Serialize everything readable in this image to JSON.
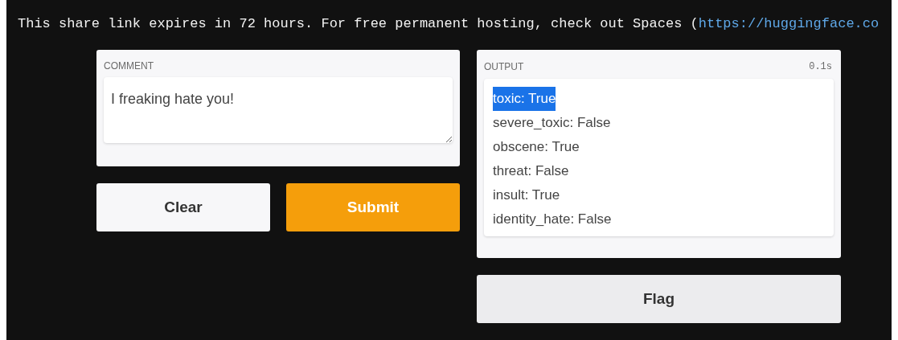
{
  "banner": {
    "text": "This share link expires in 72 hours. For free permanent hosting, check out Spaces (",
    "link": "https://huggingface.co"
  },
  "comment": {
    "label": "COMMENT",
    "value": "I freaking hate you!"
  },
  "buttons": [
    {
      "label": "Clear",
      "kind": "secondary"
    },
    {
      "label": "Submit",
      "kind": "primary"
    }
  ],
  "output": {
    "label": "OUTPUT",
    "time": "0.1s",
    "lines": [
      {
        "text": "toxic: True",
        "selected": true
      },
      {
        "text": "severe_toxic: False",
        "selected": false
      },
      {
        "text": "obscene: True",
        "selected": false
      },
      {
        "text": "threat: False",
        "selected": false
      },
      {
        "text": "insult: True",
        "selected": false
      },
      {
        "text": "identity_hate: False",
        "selected": false
      }
    ]
  },
  "flag_button": {
    "label": "Flag"
  }
}
